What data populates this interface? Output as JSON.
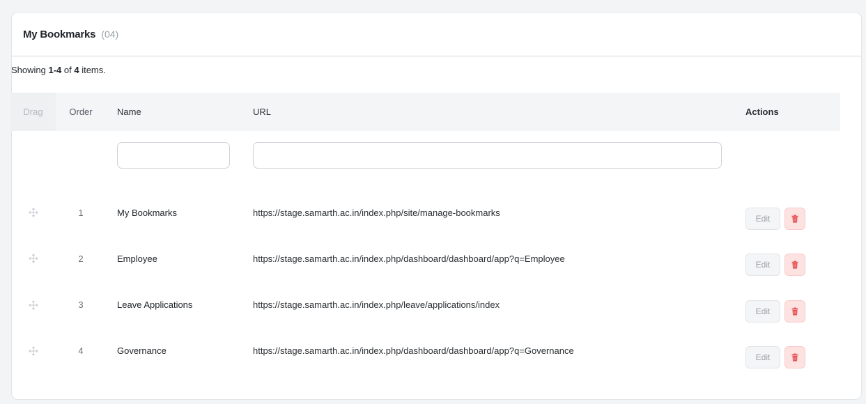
{
  "card": {
    "title": "My Bookmarks",
    "count": "(04)"
  },
  "summary": {
    "prefix": "Showing ",
    "range": "1-4",
    "middle": " of ",
    "total": "4",
    "suffix": " items."
  },
  "table": {
    "headers": {
      "drag": "Drag",
      "order": "Order",
      "name": "Name",
      "url": "URL",
      "actions": "Actions"
    },
    "filters": {
      "name": "",
      "url": ""
    },
    "rows": [
      {
        "order": "1",
        "name": "My Bookmarks",
        "url": "https://stage.samarth.ac.in/index.php/site/manage-bookmarks",
        "edit": "Edit"
      },
      {
        "order": "2",
        "name": "Employee",
        "url": "https://stage.samarth.ac.in/index.php/dashboard/dashboard/app?q=Employee",
        "edit": "Edit"
      },
      {
        "order": "3",
        "name": "Leave Applications",
        "url": "https://stage.samarth.ac.in/index.php/leave/applications/index",
        "edit": "Edit"
      },
      {
        "order": "4",
        "name": "Governance",
        "url": "https://stage.samarth.ac.in/index.php/dashboard/dashboard/app?q=Governance",
        "edit": "Edit"
      }
    ]
  },
  "icons": {
    "drag": "drag-move-icon",
    "delete": "trash-icon"
  },
  "colors": {
    "delete_bg": "#fde2e2",
    "delete_icon": "#e5484d",
    "header_bg": "#f4f5f7"
  }
}
